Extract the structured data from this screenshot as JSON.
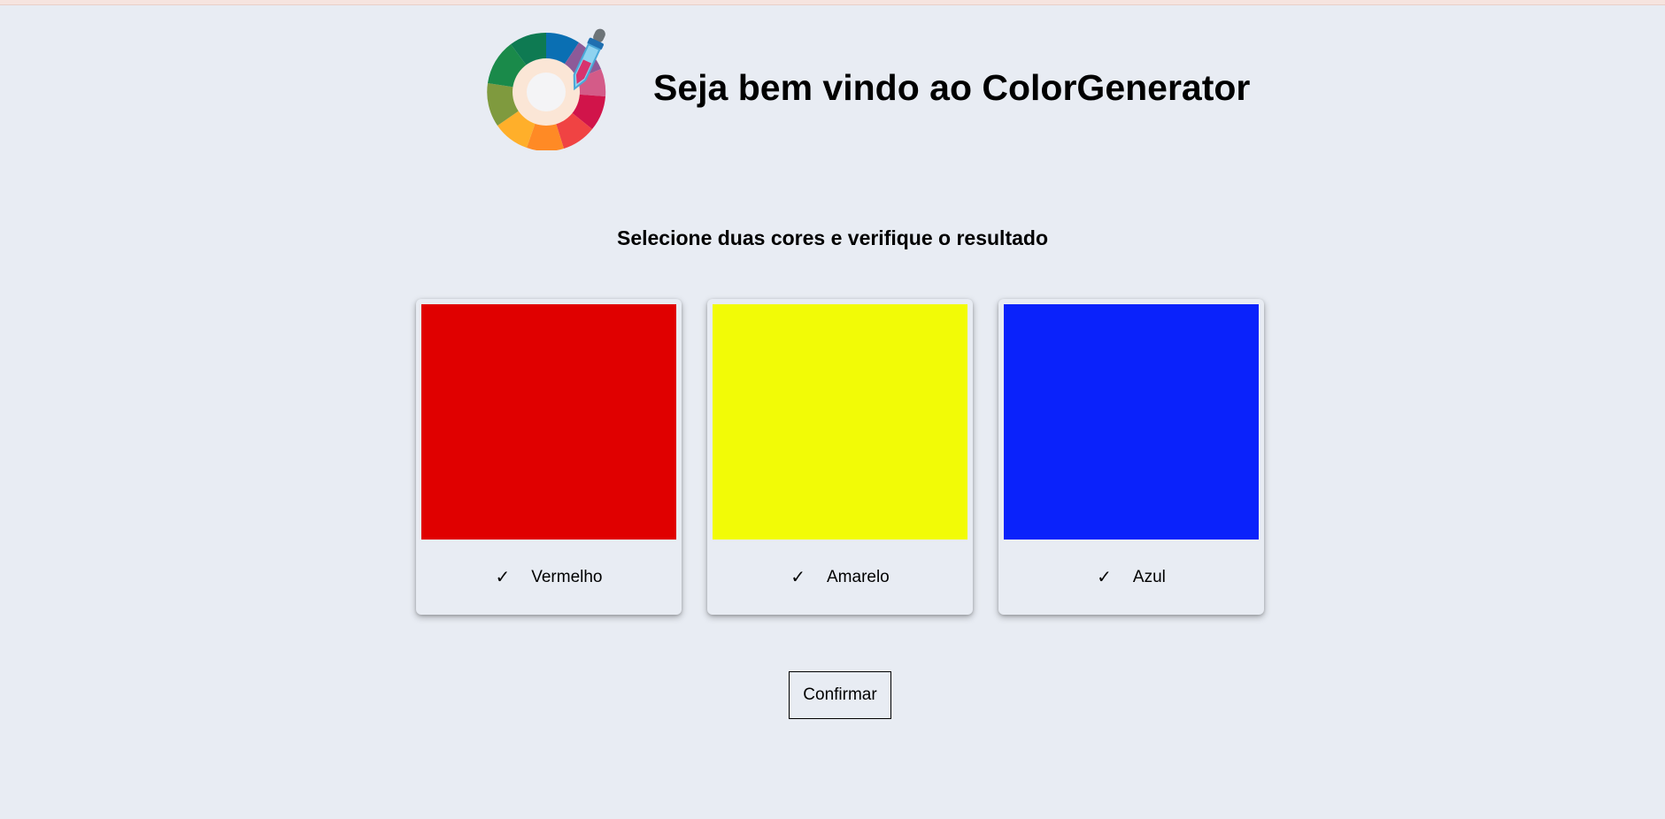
{
  "header": {
    "logo_icon": "color-wheel-dropper-icon",
    "title": "Seja bem vindo ao ColorGenerator"
  },
  "instructions": "Selecione duas cores e verifique o resultado",
  "colors": [
    {
      "label": "Vermelho",
      "hex": "#e00000",
      "selected": true,
      "icon": "checkmark-icon"
    },
    {
      "label": "Amarelo",
      "hex": "#f2fb06",
      "selected": true,
      "icon": "checkmark-icon"
    },
    {
      "label": "Azul",
      "hex": "#0a22fb",
      "selected": true,
      "icon": "checkmark-icon"
    }
  ],
  "confirm_label": "Confirmar",
  "theme": {
    "background": "#e8ecf3"
  }
}
